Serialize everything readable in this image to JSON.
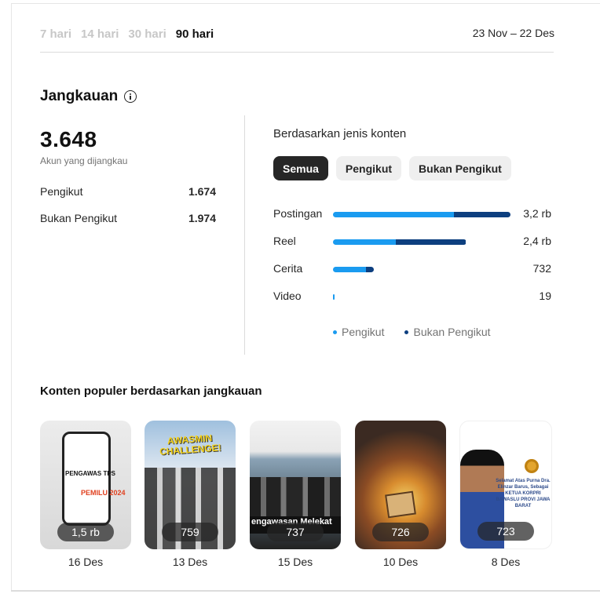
{
  "period_tabs": [
    {
      "label": "7 hari",
      "active": false
    },
    {
      "label": "14 hari",
      "active": false
    },
    {
      "label": "30 hari",
      "active": false
    },
    {
      "label": "90 hari",
      "active": true
    }
  ],
  "date_range": "23 Nov – 22 Des",
  "reach": {
    "title": "Jangkauan",
    "info_icon": "info-icon",
    "total": "3.648",
    "total_label": "Akun yang dijangkau",
    "rows": [
      {
        "label": "Pengikut",
        "value": "1.674"
      },
      {
        "label": "Bukan Pengikut",
        "value": "1.974"
      }
    ]
  },
  "by_content": {
    "title": "Berdasarkan jenis konten",
    "filters": [
      {
        "label": "Semua",
        "active": true
      },
      {
        "label": "Pengikut",
        "active": false
      },
      {
        "label": "Bukan Pengikut",
        "active": false
      }
    ],
    "bars": [
      {
        "label": "Postingan",
        "value_text": "3,2 rb",
        "total": 3200,
        "followers_share": 0.68
      },
      {
        "label": "Reel",
        "value_text": "2,4 rb",
        "total": 2400,
        "followers_share": 0.47
      },
      {
        "label": "Cerita",
        "value_text": "732",
        "total": 732,
        "followers_share": 0.82
      },
      {
        "label": "Video",
        "value_text": "19",
        "total": 19,
        "followers_share": 1.0
      }
    ],
    "legend": [
      {
        "label": "Pengikut",
        "color": "#1a9bf0"
      },
      {
        "label": "Bukan Pengikut",
        "color": "#0d3f7f"
      }
    ]
  },
  "popular": {
    "title": "Konten populer berdasarkan jangkauan",
    "items": [
      {
        "count": "1,5 rb",
        "date": "16 Des",
        "caption": "PENGAWAS TPS",
        "caption2": "PEMILU 2024"
      },
      {
        "count": "759",
        "date": "13 Des",
        "caption": "AWASMIN CHALLENGE!"
      },
      {
        "count": "737",
        "date": "15 Des",
        "caption": "engawasan Melekat"
      },
      {
        "count": "726",
        "date": "10 Des"
      },
      {
        "count": "723",
        "date": "8 Des",
        "caption": "Selamat Atas Purna Dra. Elinzar Barus, Sebagai KETUA KORPRI BAWASLU PROVI JAWA BARAT"
      }
    ]
  }
}
